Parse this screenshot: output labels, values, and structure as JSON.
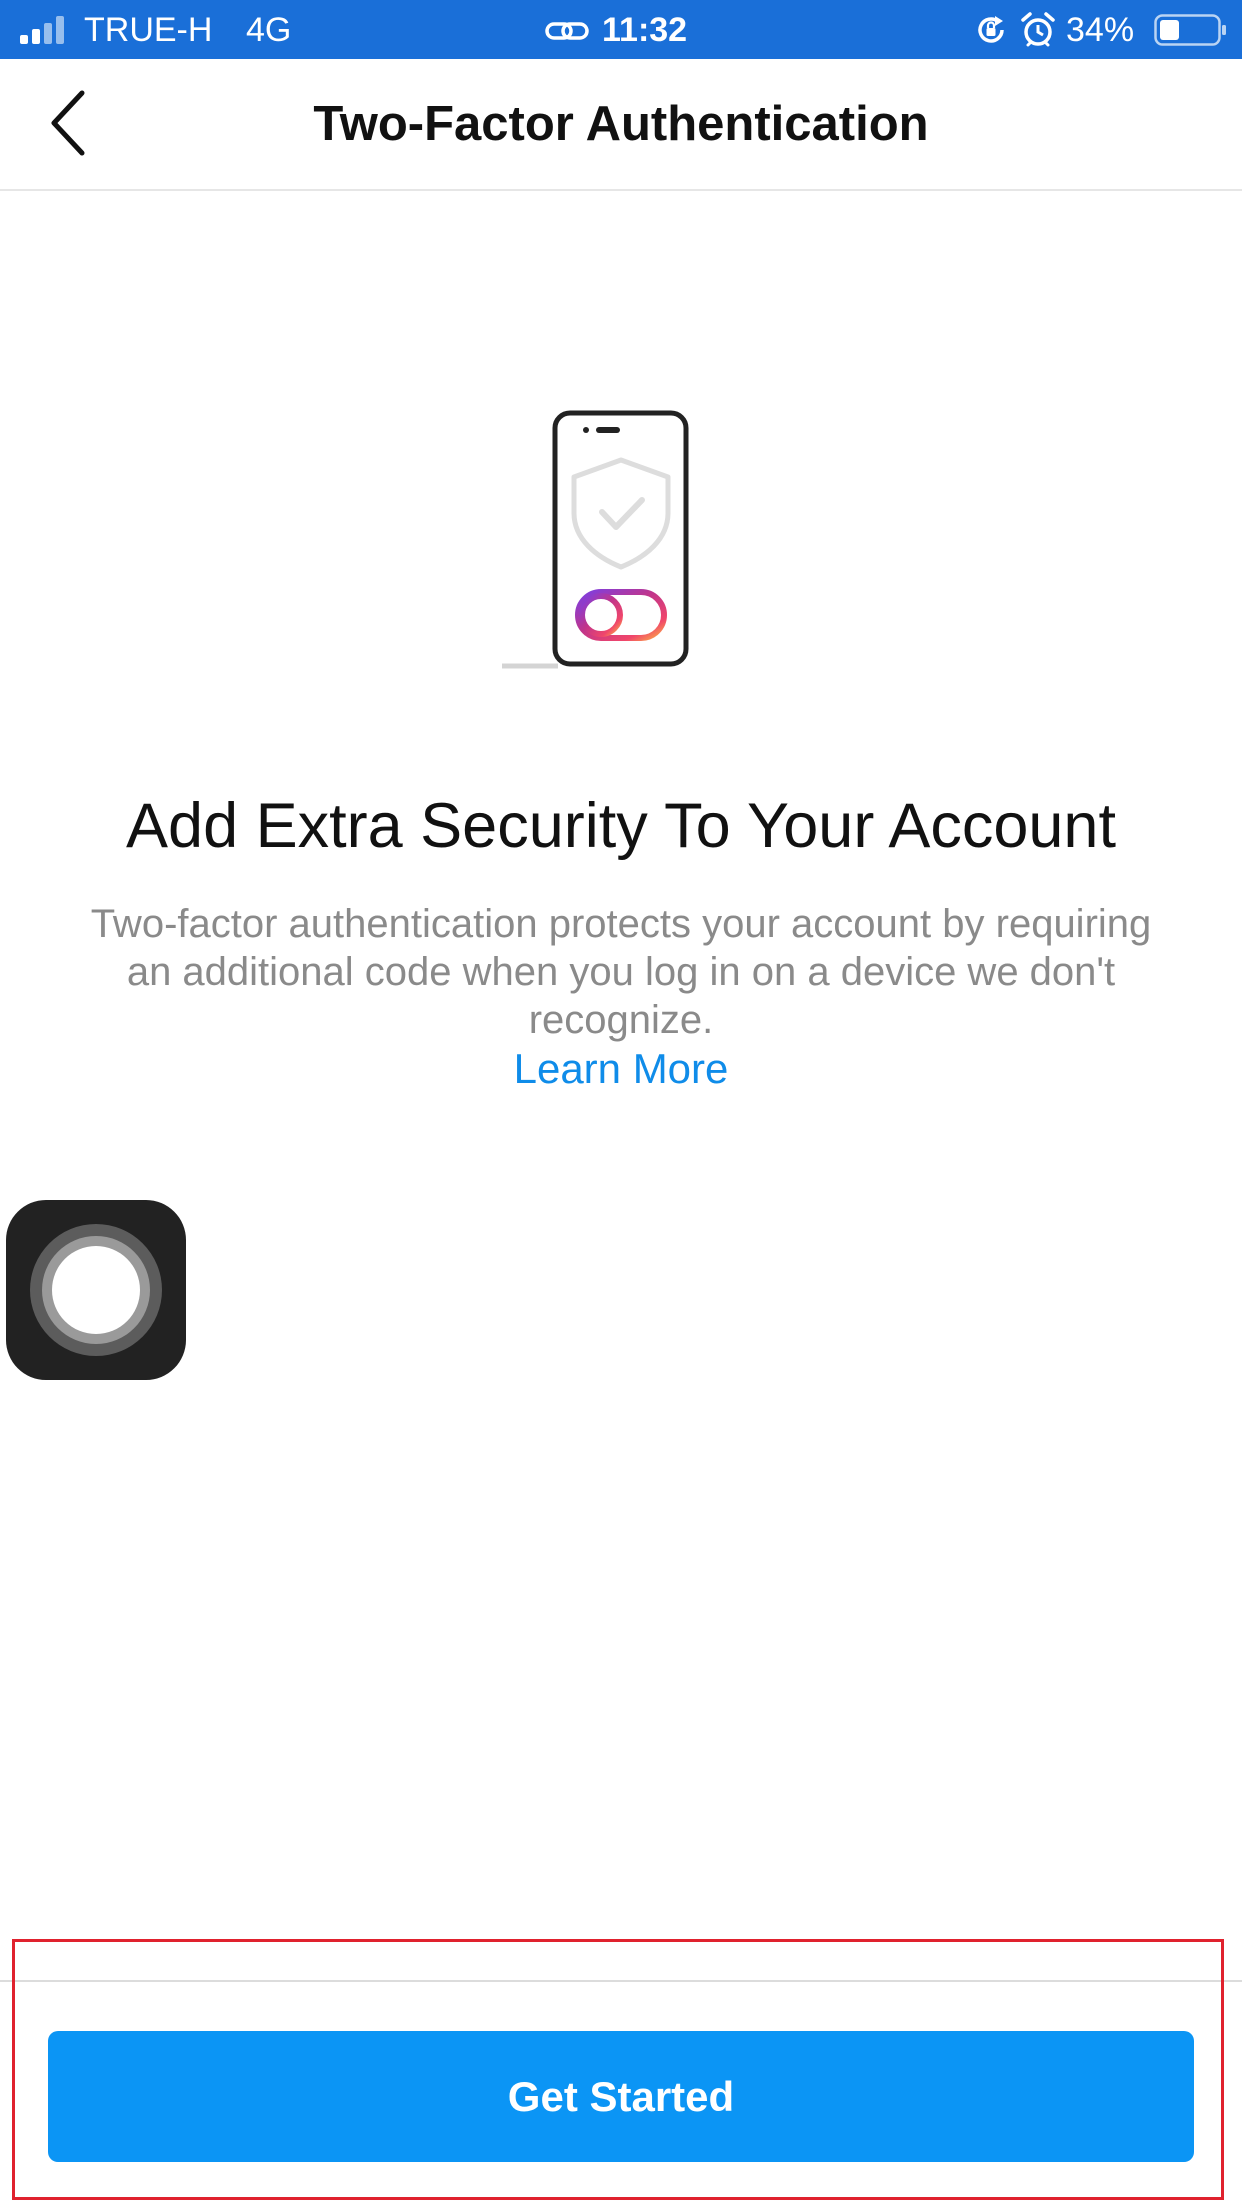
{
  "status_bar": {
    "carrier": "TRUE-H",
    "network": "4G",
    "time": "11:32",
    "battery": "34%",
    "battery_level": 0.34,
    "background_color": "#1a6fd8",
    "icons": [
      "signal-icon",
      "link-icon",
      "rotation-lock-icon",
      "alarm-icon",
      "battery-icon"
    ]
  },
  "nav": {
    "title": "Two-Factor Authentication",
    "back_icon": "chevron-left-icon"
  },
  "illustration": {
    "icons": [
      "phone-icon",
      "shield-check-icon",
      "toggle-switch-icon"
    ]
  },
  "content": {
    "headline": "Add Extra Security To Your Account",
    "description": "Two-factor authentication protects your account by requiring an additional code when you log in on a device we don't recognize.",
    "learn_more": "Learn More"
  },
  "footer": {
    "button_label": "Get Started",
    "button_color": "#0b95f5"
  },
  "overlay": {
    "assistive_touch_icon": "assistive-touch-icon",
    "highlight_color": "#e0222e"
  },
  "colors": {
    "link": "#0f8ce9",
    "muted_text": "#8a8a8a"
  }
}
